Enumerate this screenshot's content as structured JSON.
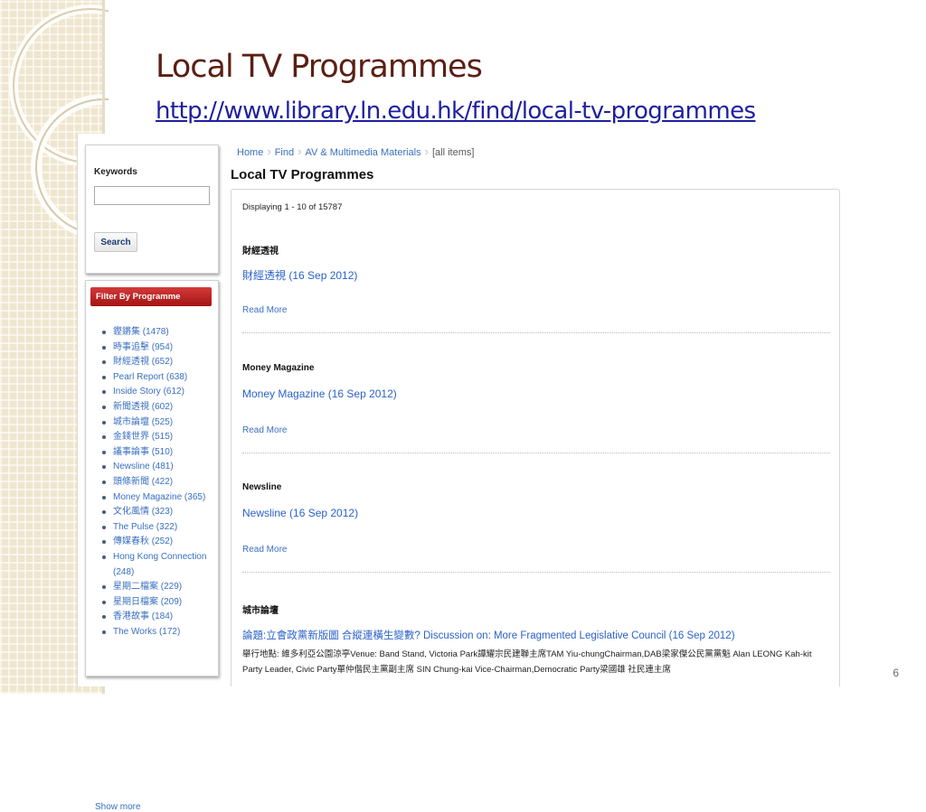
{
  "slide": {
    "title": "Local TV Programmes",
    "link": "http://www.library.ln.edu.hk/find/local-tv-programmes",
    "number": "6"
  },
  "sidebar": {
    "keywords_label": "Keywords",
    "keywords_value": "",
    "search_label": "Search",
    "filter_header": "Filter By Programme",
    "programmes": [
      {
        "label": "鏗鏘集 (1478)"
      },
      {
        "label": "時事追擊 (954)"
      },
      {
        "label": "財經透視 (652)"
      },
      {
        "label": "Pearl Report (638)"
      },
      {
        "label": "Inside Story (612)"
      },
      {
        "label": "新聞透視 (602)"
      },
      {
        "label": "城市論壇 (525)"
      },
      {
        "label": "金錢世界 (515)"
      },
      {
        "label": "議事論事 (510)"
      },
      {
        "label": "Newsline (481)"
      },
      {
        "label": "頭條新聞 (422)"
      },
      {
        "label": "Money Magazine (365)"
      },
      {
        "label": "文化風情 (323)"
      },
      {
        "label": "The Pulse (322)"
      },
      {
        "label": "傳媒春秋 (252)"
      },
      {
        "label": "Hong Kong Connection (248)"
      },
      {
        "label": "星期二檔案 (229)"
      },
      {
        "label": "星期日檔案 (209)"
      },
      {
        "label": "香港故事 (184)"
      },
      {
        "label": "The Works (172)"
      }
    ],
    "show_more": "Show more"
  },
  "breadcrumb": {
    "home": "Home",
    "find": "Find",
    "av": "AV & Multimedia Materials",
    "all": "[all items]"
  },
  "main": {
    "heading": "Local TV Programmes",
    "displaying": "Displaying 1 - 10 of 15787",
    "results": [
      {
        "category": "財經透視",
        "title": "財經透視 (16 Sep 2012)",
        "read_more": "Read More"
      },
      {
        "category": "Money Magazine",
        "title": "Money Magazine (16 Sep 2012)",
        "read_more": "Read More"
      },
      {
        "category": "Newsline",
        "title": "Newsline (16 Sep 2012)",
        "read_more": "Read More"
      },
      {
        "category": "城市論壇",
        "title": "論題:立會政黨新版圖 合縱連橫生變數? Discussion on: More Fragmented Legislative Council (16 Sep 2012)",
        "description": "舉行地點: 維多利亞公園涼亭Venue: Band Stand, Victoria Park譚耀宗民建聯主席TAM Yiu-chungChairman,DAB梁家傑公民黨黨魁 Alan LEONG Kah-kit Party Leader, Civic Party單仲偕民主黨副主席 SIN Chung-kai Vice-Chairman,Democratic Party梁國雄 社民連主席"
      }
    ]
  }
}
